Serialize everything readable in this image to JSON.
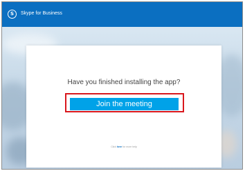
{
  "app": {
    "title": "Skype for Business",
    "logo_icon": "skype-logo-icon",
    "logo_glyph": "S",
    "brand_color": "#0b6fc1"
  },
  "dialog": {
    "question": "Have you finished installing the app?",
    "join_button_label": "Join the meeting",
    "join_button_color": "#00a2e8",
    "highlight_color": "#d9161c",
    "help": {
      "prefix": "Click",
      "link": "here",
      "suffix": "for more help"
    }
  }
}
